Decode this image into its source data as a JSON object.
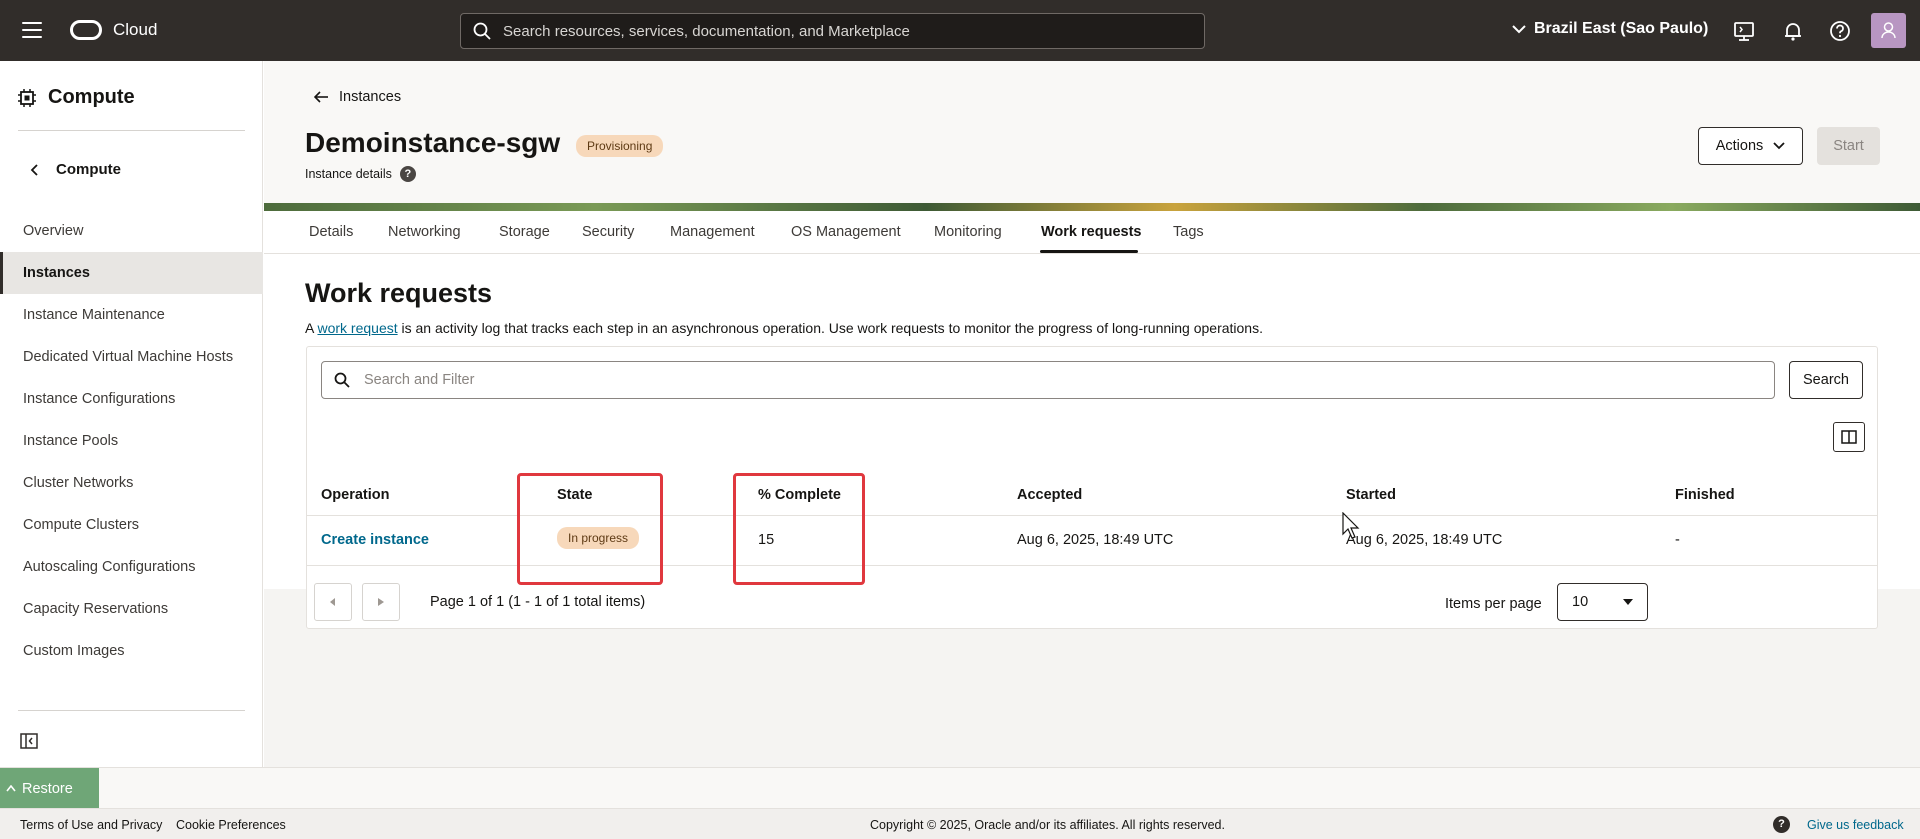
{
  "topbar": {
    "brand": "Cloud",
    "search_placeholder": "Search resources, services, documentation, and Marketplace",
    "region": "Brazil East (Sao Paulo)"
  },
  "sidebar": {
    "title": "Compute",
    "back_label": "Compute",
    "items": [
      {
        "label": "Overview"
      },
      {
        "label": "Instances"
      },
      {
        "label": "Instance Maintenance"
      },
      {
        "label": "Dedicated Virtual Machine Hosts"
      },
      {
        "label": "Instance Configurations"
      },
      {
        "label": "Instance Pools"
      },
      {
        "label": "Cluster Networks"
      },
      {
        "label": "Compute Clusters"
      },
      {
        "label": "Autoscaling Configurations"
      },
      {
        "label": "Capacity Reservations"
      },
      {
        "label": "Custom Images"
      }
    ]
  },
  "header": {
    "breadcrumb": "Instances",
    "title": "Demoinstance-sgw",
    "status": "Provisioning",
    "subtitle": "Instance details",
    "actions_label": "Actions",
    "start_label": "Start"
  },
  "tabs": [
    "Details",
    "Networking",
    "Storage",
    "Security",
    "Management",
    "OS Management",
    "Monitoring",
    "Work requests",
    "Tags"
  ],
  "work_requests": {
    "title": "Work requests",
    "desc_prefix": "A ",
    "desc_link": "work request",
    "desc_suffix": " is an activity log that tracks each step in an asynchronous operation. Use work requests to monitor the progress of long-running operations.",
    "filter_placeholder": "Search and Filter",
    "search_label": "Search",
    "columns": [
      "Operation",
      "State",
      "% Complete",
      "Accepted",
      "Started",
      "Finished"
    ],
    "rows": [
      {
        "operation": "Create instance",
        "state": "In progress",
        "percent_complete": "15",
        "accepted": "Aug 6, 2025, 18:49 UTC",
        "started": "Aug 6, 2025, 18:49 UTC",
        "finished": "-"
      }
    ],
    "page_info": "Page 1 of 1 (1 - 1 of 1 total items)",
    "items_per_page_label": "Items per page",
    "items_per_page": "10"
  },
  "bottom": {
    "restore_label": "Restore",
    "terms": "Terms of Use and Privacy",
    "cookies": "Cookie Preferences",
    "copyright": "Copyright © 2025, Oracle and/or its affiliates. All rights reserved.",
    "feedback": "Give us feedback"
  },
  "colors": {
    "topbar": "#312d2a",
    "link": "#00688c",
    "badge": "#f7d8ba",
    "highlight": "#e0383e",
    "restore": "#6fa677"
  }
}
